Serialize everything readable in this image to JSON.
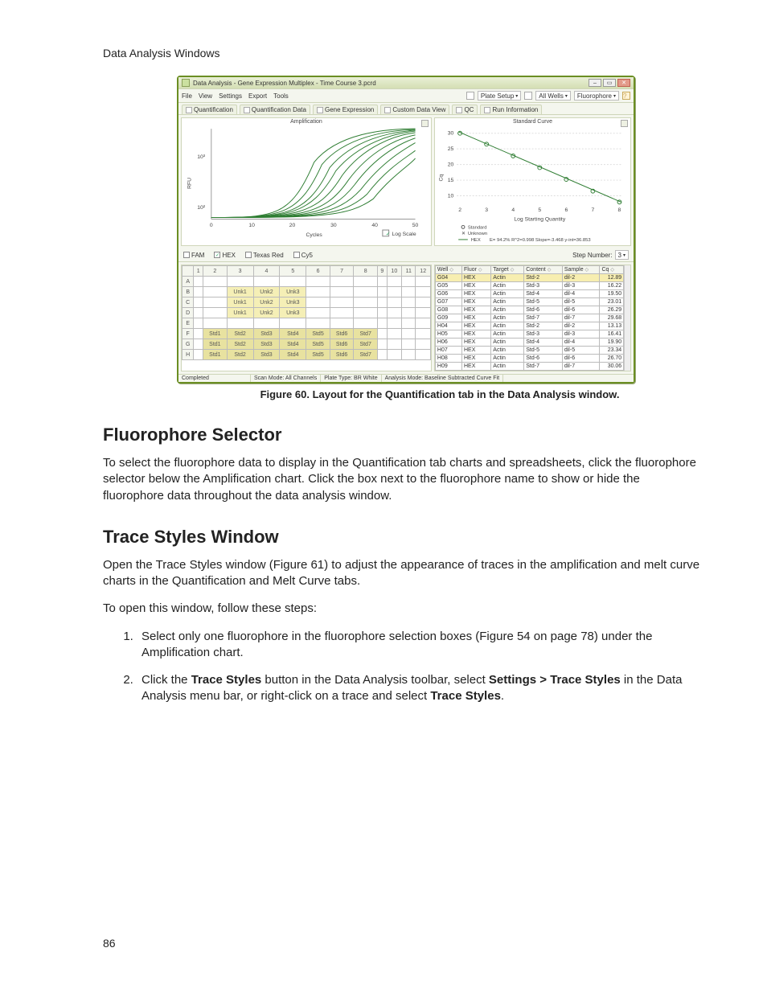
{
  "page": {
    "running_head": "Data Analysis Windows",
    "number": "86"
  },
  "app": {
    "title": "Data Analysis - Gene Expression Multiplex - Time Course 3.pcrd",
    "menu": [
      "File",
      "View",
      "Settings",
      "Export",
      "Tools"
    ],
    "toolbar": {
      "plate_setup": "Plate Setup",
      "wells": "All Wells",
      "mode": "Fluorophore",
      "help": "?"
    },
    "tabs": [
      "Quantification",
      "Quantification Data",
      "Gene Expression",
      "Custom Data View",
      "QC",
      "Run Information"
    ],
    "amp": {
      "title": "Amplification",
      "ylabel": "RFU",
      "xlabel": "Cycles",
      "logscale": "Log Scale"
    },
    "std": {
      "title": "Standard Curve",
      "ylabel": "Cq",
      "xlabel": "Log Starting Quantity",
      "legend": {
        "standard": "Standard",
        "unknown": "Unknown",
        "series": "HEX",
        "eq": "E= 94.2% R^2=0.998 Slope=-3.468 y-int=36.853"
      }
    },
    "fluor": {
      "items": [
        {
          "label": "FAM",
          "checked": false
        },
        {
          "label": "HEX",
          "checked": true
        },
        {
          "label": "Texas Red",
          "checked": false
        },
        {
          "label": "Cy5",
          "checked": false
        }
      ],
      "step_label": "Step Number:",
      "step_value": "3"
    },
    "plate": {
      "cols": [
        "1",
        "2",
        "3",
        "4",
        "5",
        "6",
        "7",
        "8",
        "9",
        "10",
        "11",
        "12"
      ],
      "rows": [
        "A",
        "B",
        "C",
        "D",
        "E",
        "F",
        "G",
        "H"
      ],
      "cells": {
        "B": {
          "3": "Unk1",
          "4": "Unk2",
          "5": "Unk3"
        },
        "C": {
          "3": "Unk1",
          "4": "Unk2",
          "5": "Unk3"
        },
        "D": {
          "3": "Unk1",
          "4": "Unk2",
          "5": "Unk3"
        },
        "F": {
          "2": "Std1",
          "3": "Std2",
          "4": "Std3",
          "5": "Std4",
          "6": "Std5",
          "7": "Std6",
          "8": "Std7"
        },
        "G": {
          "2": "Std1",
          "3": "Std2",
          "4": "Std3",
          "5": "Std4",
          "6": "Std5",
          "7": "Std6",
          "8": "Std7"
        },
        "H": {
          "2": "Std1",
          "3": "Std2",
          "4": "Std3",
          "5": "Std4",
          "6": "Std5",
          "7": "Std6",
          "8": "Std7"
        }
      }
    },
    "datatable": {
      "headers": [
        "Well",
        "Fluor",
        "Target",
        "Content",
        "Sample",
        "Cq"
      ],
      "rows": [
        {
          "sel": true,
          "c": [
            "G04",
            "HEX",
            "Actin",
            "Std-2",
            "dil-2",
            "12.89"
          ]
        },
        {
          "c": [
            "G05",
            "HEX",
            "Actin",
            "Std-3",
            "dil-3",
            "16.22"
          ]
        },
        {
          "c": [
            "G06",
            "HEX",
            "Actin",
            "Std-4",
            "dil-4",
            "19.50"
          ]
        },
        {
          "c": [
            "G07",
            "HEX",
            "Actin",
            "Std-5",
            "dil-5",
            "23.01"
          ]
        },
        {
          "c": [
            "G08",
            "HEX",
            "Actin",
            "Std-6",
            "dil-6",
            "26.29"
          ]
        },
        {
          "c": [
            "G09",
            "HEX",
            "Actin",
            "Std-7",
            "dil-7",
            "29.68"
          ]
        },
        {
          "c": [
            "H04",
            "HEX",
            "Actin",
            "Std-2",
            "dil-2",
            "13.13"
          ]
        },
        {
          "c": [
            "H05",
            "HEX",
            "Actin",
            "Std-3",
            "dil-3",
            "16.41"
          ]
        },
        {
          "c": [
            "H06",
            "HEX",
            "Actin",
            "Std-4",
            "dil-4",
            "19.90"
          ]
        },
        {
          "c": [
            "H07",
            "HEX",
            "Actin",
            "Std-5",
            "dil-5",
            "23.34"
          ]
        },
        {
          "c": [
            "H08",
            "HEX",
            "Actin",
            "Std-6",
            "dil-6",
            "26.70"
          ]
        },
        {
          "c": [
            "H09",
            "HEX",
            "Actin",
            "Std-7",
            "dil-7",
            "30.06"
          ]
        }
      ]
    },
    "status": {
      "state": "Completed",
      "scan": "Scan Mode: All Channels",
      "plate_type": "Plate Type: BR White",
      "analysis": "Analysis Mode: Baseline Subtracted Curve Fit"
    }
  },
  "caption": "Figure 60. Layout for the Quantification tab in the Data Analysis window.",
  "h2a": "Fluorophore Selector",
  "p1": "To select the fluorophore data to display in the Quantification tab charts and spreadsheets, click the fluorophore selector below the Amplification chart. Click the box next to the fluorophore name to show or hide the fluorophore data throughout the data analysis window.",
  "h2b": "Trace Styles Window",
  "p2": "Open the Trace Styles window (Figure 61) to adjust the appearance of traces in the amplification and melt curve charts in the Quantification and Melt Curve tabs.",
  "p3": "To open this window, follow these steps:",
  "li1": "Select only one fluorophore in the fluorophore selection boxes (Figure 54 on page 78) under the Amplification chart.",
  "li2a": "Click the ",
  "li2b": "Trace Styles",
  "li2c": " button in the Data Analysis toolbar, select ",
  "li2d": "Settings > Trace Styles",
  "li2e": " in the Data Analysis menu bar, or right-click on a trace and select ",
  "li2f": "Trace Styles",
  "li2g": ".",
  "chart_data": {
    "type": "line",
    "title": "Standard Curve",
    "xlabel": "Log Starting Quantity",
    "ylabel": "Cq",
    "xlim": [
      2,
      8.5
    ],
    "ylim": [
      8,
      32
    ],
    "series": [
      {
        "name": "HEX Standard",
        "x": [
          2,
          3,
          4,
          5,
          6,
          7,
          8
        ],
        "y": [
          30,
          27,
          23,
          20,
          16,
          13,
          9
        ]
      }
    ],
    "annotation": "E= 94.2% R^2=0.998 Slope=-3.468 y-int=36.853"
  }
}
